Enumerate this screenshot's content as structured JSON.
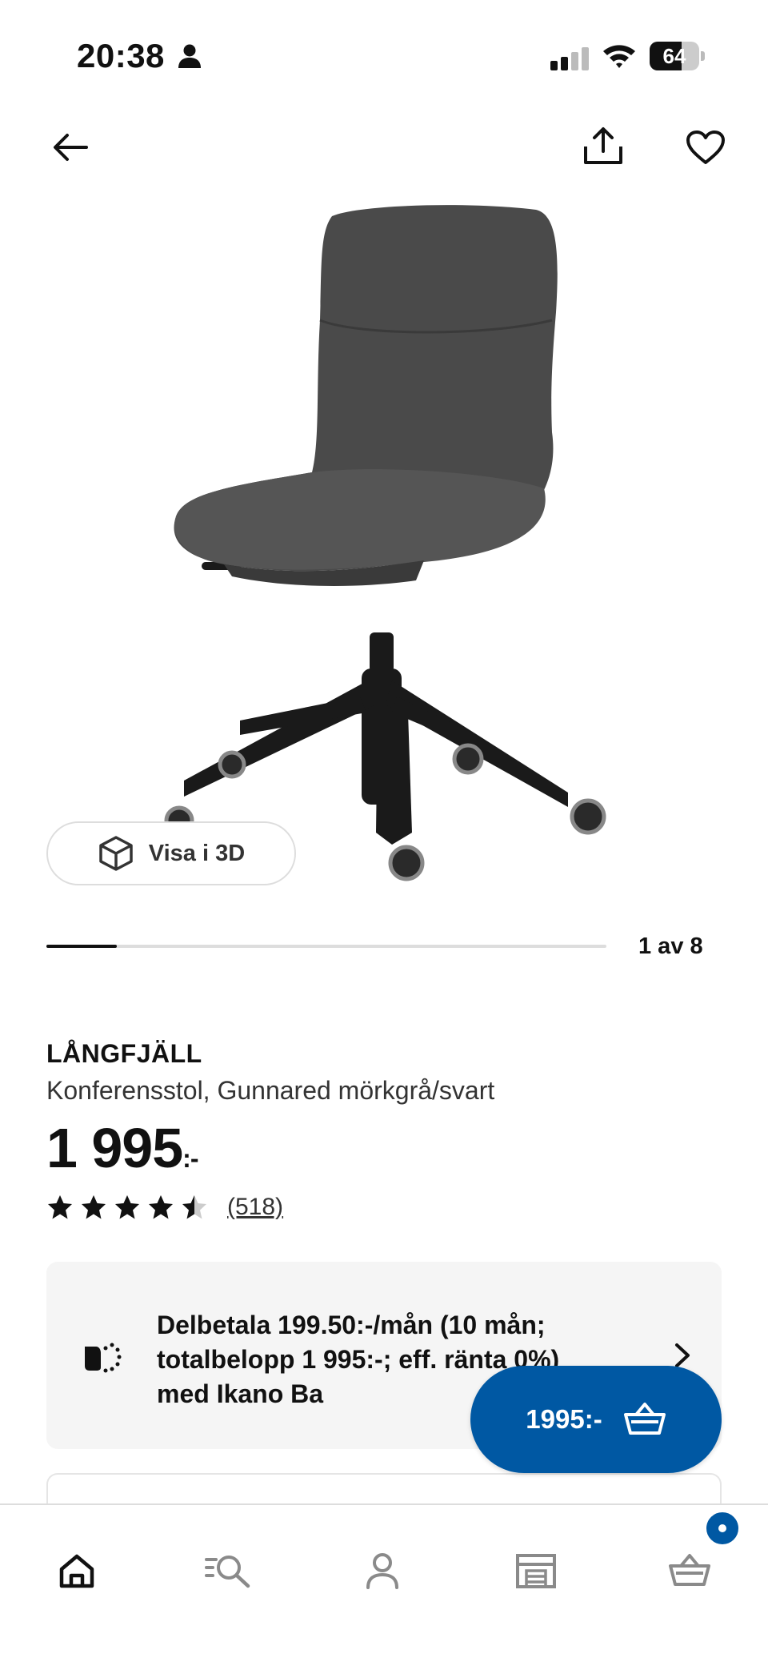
{
  "status_bar": {
    "time": "20:38",
    "battery": "64",
    "battery_level": 0.64
  },
  "product": {
    "name": "LÅNGFJÄLL",
    "description": "Konferensstol, Gunnared mörkgrå/svart",
    "price": "1 995",
    "price_suffix": ":-",
    "rating": 4.5,
    "rating_max": 5,
    "review_count": "(518)"
  },
  "gallery": {
    "visa3d_label": "Visa i 3D",
    "counter": "1 av 8",
    "current": 1,
    "total": 8
  },
  "finance": {
    "text": "Delbetala 199.50:-/mån (10 mån; totalbelopp 1 995:-; eff. ränta 0%) med Ikano Ba"
  },
  "cart_button": {
    "price": "1995:-"
  },
  "colors": {
    "brand_blue": "#0058a3",
    "card_bg": "#f5f5f5",
    "chair_fabric": "#4a4a4a",
    "chair_base": "#1a1a1a"
  },
  "icons": {
    "back": "arrow-left-icon",
    "share": "share-icon",
    "favorite": "heart-icon",
    "visa3d": "cube-icon",
    "finance": "basket-dotted-icon",
    "chevron": "chevron-right-icon",
    "cart": "basket-icon",
    "tabs": [
      "home-icon",
      "search-list-icon",
      "person-icon",
      "store-icon",
      "basket-icon"
    ]
  }
}
